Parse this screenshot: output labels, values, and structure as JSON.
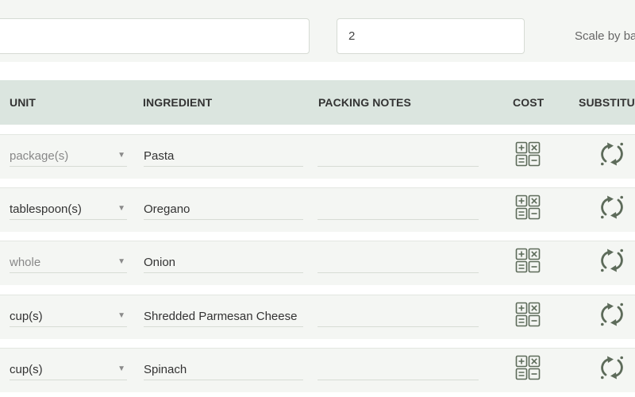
{
  "top": {
    "first_input_value": "",
    "scale_value": "2",
    "scale_label": "Scale by ba"
  },
  "table": {
    "headers": {
      "unit": "UNIT",
      "ingredient": "INGREDIENT",
      "packing_notes": "PACKING NOTES",
      "cost": "COST",
      "substitute": "SUBSTITUT"
    },
    "rows": [
      {
        "unit": "package(s)",
        "ingredient": "Pasta",
        "packing_notes": ""
      },
      {
        "unit": "tablespoon(s)",
        "ingredient": "Oregano",
        "packing_notes": ""
      },
      {
        "unit": "whole",
        "ingredient": "Onion",
        "packing_notes": ""
      },
      {
        "unit": "cup(s)",
        "ingredient": "Shredded Parmesan Cheese",
        "packing_notes": ""
      },
      {
        "unit": "cup(s)",
        "ingredient": "Spinach",
        "packing_notes": ""
      }
    ],
    "row_icons": {
      "cost": "calculator-icon",
      "substitute": "swap-cycle-icon",
      "dropdown": "chevron-down-icon"
    }
  },
  "colors": {
    "header_bg": "#dbe5df",
    "row_bg": "#f4f6f3",
    "icon": "#5d6b5a"
  }
}
